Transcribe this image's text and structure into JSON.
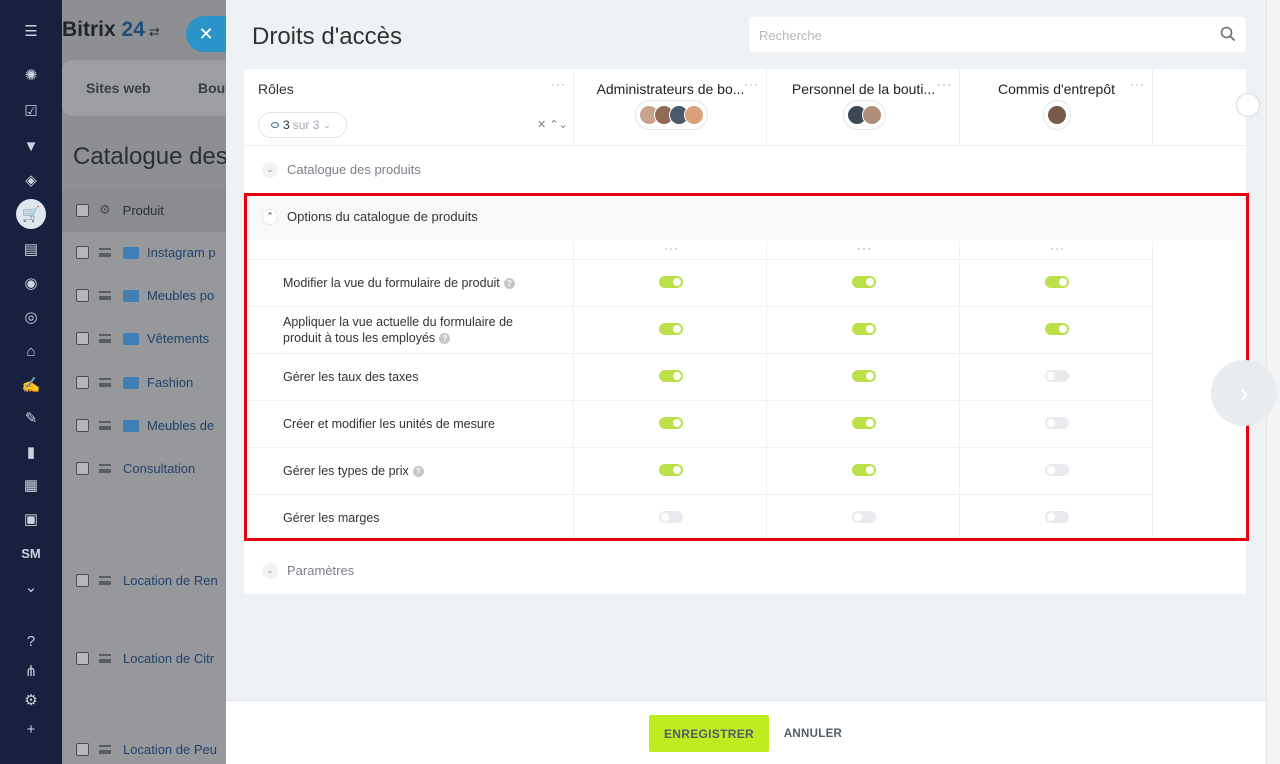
{
  "app": {
    "logo_name": "Bitrix",
    "logo_number": "24",
    "logo_icon": "swap-icon",
    "close_icon": "close-icon"
  },
  "leftnav": {
    "items": [
      {
        "name": "menu-icon",
        "glyph": "☰"
      },
      {
        "name": "activity-icon",
        "glyph": "✺"
      },
      {
        "name": "tasks-icon",
        "glyph": "☑"
      },
      {
        "name": "filter-icon",
        "glyph": "▼"
      },
      {
        "name": "box-icon",
        "glyph": "◈"
      },
      {
        "name": "cart-icon",
        "glyph": "🛒",
        "active": true
      },
      {
        "name": "contact-card-icon",
        "glyph": "▤"
      },
      {
        "name": "robot-icon",
        "glyph": "◉"
      },
      {
        "name": "target-icon",
        "glyph": "◎"
      },
      {
        "name": "bank-icon",
        "glyph": "⌂"
      },
      {
        "name": "sign-icon",
        "glyph": "✍"
      },
      {
        "name": "edit-doc-icon",
        "glyph": "✎"
      },
      {
        "name": "chart-icon",
        "glyph": "▮"
      },
      {
        "name": "calendar-icon",
        "glyph": "▦"
      },
      {
        "name": "video-icon",
        "glyph": "▣"
      },
      {
        "name": "sm-text",
        "text": "SM"
      },
      {
        "name": "chevron-down-circle-icon",
        "glyph": "⌄"
      },
      {
        "name": "help-icon",
        "glyph": "?"
      },
      {
        "name": "network-icon",
        "glyph": "⋔"
      },
      {
        "name": "settings-icon",
        "glyph": "⚙"
      },
      {
        "name": "plus-icon",
        "glyph": "+"
      }
    ]
  },
  "background": {
    "tabs": [
      "Sites web",
      "Bout"
    ],
    "title": "Catalogue des",
    "table_header": "Produit",
    "rows": [
      {
        "label": "Instagram p",
        "folder": true
      },
      {
        "label": "Meubles po",
        "folder": true
      },
      {
        "label": "Vêtements",
        "folder": true
      },
      {
        "label": "Fashion",
        "folder": true
      },
      {
        "label": "Meubles de",
        "folder": true
      },
      {
        "label": "Consultation",
        "folder": false
      },
      {
        "label": "Location de Ren",
        "folder": false
      },
      {
        "label": "Location de Citr",
        "folder": false
      },
      {
        "label": "Location de Peu",
        "folder": false
      }
    ]
  },
  "panel": {
    "title": "Droits d'accès",
    "search_placeholder": "Recherche",
    "roles_label": "Rôles",
    "roles_count": "3",
    "roles_of": "sur 3",
    "more": "···",
    "roles": [
      {
        "name": "Administrateurs de bo...",
        "avatars": [
          "#c9a48c",
          "#8f6b55",
          "#4a5a6a",
          "#d9a17a"
        ]
      },
      {
        "name": "Personnel de la bouti...",
        "avatars": [
          "#3d4756",
          "#b08f7a"
        ]
      },
      {
        "name": "Commis d'entrepôt",
        "avatars": [
          "#7a5b4a"
        ]
      }
    ],
    "sections": {
      "catalogue": "Catalogue des produits",
      "options": "Options du catalogue de produits",
      "parametres": "Paramètres"
    },
    "permissions": [
      {
        "label": "Modifier la vue du formulaire de produit",
        "help": true,
        "values": [
          true,
          true,
          true
        ]
      },
      {
        "label": "Appliquer la vue actuelle du formulaire de produit à tous les employés",
        "help": true,
        "values": [
          true,
          true,
          true
        ]
      },
      {
        "label": "Gérer les taux des taxes",
        "help": false,
        "values": [
          true,
          true,
          false
        ]
      },
      {
        "label": "Créer et modifier les unités de mesure",
        "help": false,
        "values": [
          true,
          true,
          false
        ]
      },
      {
        "label": "Gérer les types de prix",
        "help": true,
        "values": [
          true,
          true,
          false
        ]
      },
      {
        "label": "Gérer les marges",
        "help": false,
        "values": [
          false,
          false,
          false
        ]
      }
    ]
  },
  "footer": {
    "save": "ENREGISTRER",
    "cancel": "ANNULER"
  },
  "colors": {
    "toggle_on": "#bbe04a",
    "toggle_off": "#e8eaed",
    "highlight_box": "#e3000f",
    "save_button": "#bbed21"
  }
}
